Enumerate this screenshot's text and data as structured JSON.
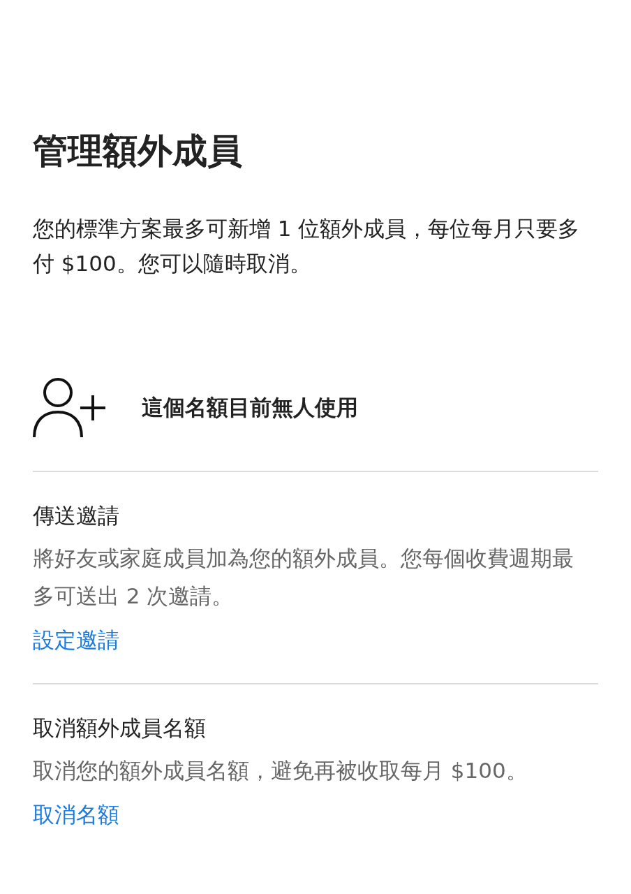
{
  "title": "管理額外成員",
  "intro": "您的標準方案最多可新增 1 位額外成員，每位每月只要多付 $100。您可以隨時取消。",
  "slot": {
    "label": "這個名額目前無人使用"
  },
  "sections": [
    {
      "heading": "傳送邀請",
      "description": "將好友或家庭成員加為您的額外成員。您每個收費週期最多可送出 2 次邀請。",
      "link": "設定邀請"
    },
    {
      "heading": "取消額外成員名額",
      "description": "取消您的額外成員名額，避免再被收取每月 $100。",
      "link": "取消名額"
    }
  ]
}
